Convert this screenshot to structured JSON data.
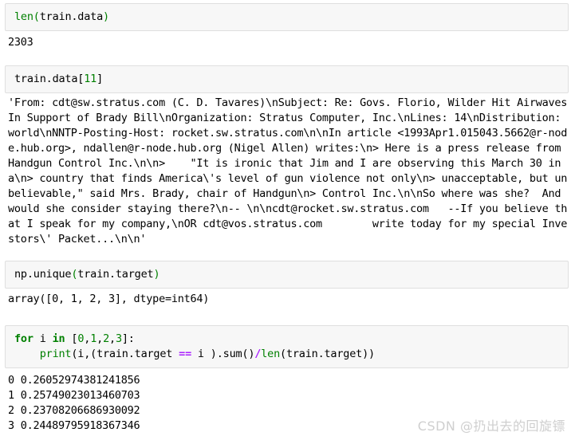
{
  "document": {
    "kind": "jupyter-notebook",
    "watermark": "CSDN @扔出去的回旋镖"
  },
  "cells": [
    {
      "id": "cell-1",
      "type": "code",
      "source_plain": "len(train.data)",
      "tokens": [
        {
          "t": "len",
          "c": "tok-builtin"
        },
        {
          "t": "(",
          "c": "tok-paren"
        },
        {
          "t": "train.data",
          "c": "tok-plain"
        },
        {
          "t": ")",
          "c": "tok-paren"
        }
      ],
      "output": {
        "type": "execute_result",
        "text": "2303"
      }
    },
    {
      "id": "cell-2",
      "type": "code",
      "source_plain": "train.data[11]",
      "tokens": [
        {
          "t": "train.data[",
          "c": "tok-plain"
        },
        {
          "t": "11",
          "c": "tok-number"
        },
        {
          "t": "]",
          "c": "tok-plain"
        }
      ],
      "output": {
        "type": "execute_result",
        "text": "'From: cdt@sw.stratus.com (C. D. Tavares)\\nSubject: Re: Govs. Florio, Wilder Hit Airwaves In Support of Brady Bill\\nOrganization: Stratus Computer, Inc.\\nLines: 14\\nDistribution: world\\nNNTP-Posting-Host: rocket.sw.stratus.com\\n\\nIn article <1993Apr1.015043.5662@r-node.hub.org>, ndallen@r-node.hub.org (Nigel Allen) writes:\\n> Here is a press release from Handgun Control Inc.\\n\\n>    \"It is ironic that Jim and I are observing this March 30 in a\\n> country that finds America\\'s level of gun violence not only\\n> unacceptable, but unbelievable,\" said Mrs. Brady, chair of Handgun\\n> Control Inc.\\n\\nSo where was she?  And would she consider staying there?\\n-- \\n\\ncdt@rocket.sw.stratus.com   --If you believe that I speak for my company,\\nOR cdt@vos.stratus.com        write today for my special Investors\\' Packet...\\n\\n'"
      }
    },
    {
      "id": "cell-3",
      "type": "code",
      "source_plain": "np.unique(train.target)",
      "tokens": [
        {
          "t": "np.unique",
          "c": "tok-plain"
        },
        {
          "t": "(",
          "c": "tok-paren"
        },
        {
          "t": "train.target",
          "c": "tok-plain"
        },
        {
          "t": ")",
          "c": "tok-paren"
        }
      ],
      "output": {
        "type": "execute_result",
        "text": "array([0, 1, 2, 3], dtype=int64)"
      }
    },
    {
      "id": "cell-4",
      "type": "code",
      "source_plain": "for i in [0,1,2,3]:\n    print(i,(train.target == i ).sum()/len(train.target))",
      "lines": [
        [
          {
            "t": "for",
            "c": "tok-keyword"
          },
          {
            "t": " i ",
            "c": "tok-plain"
          },
          {
            "t": "in",
            "c": "tok-keyword"
          },
          {
            "t": " [",
            "c": "tok-plain"
          },
          {
            "t": "0",
            "c": "tok-number"
          },
          {
            "t": ",",
            "c": "tok-plain"
          },
          {
            "t": "1",
            "c": "tok-number"
          },
          {
            "t": ",",
            "c": "tok-plain"
          },
          {
            "t": "2",
            "c": "tok-number"
          },
          {
            "t": ",",
            "c": "tok-plain"
          },
          {
            "t": "3",
            "c": "tok-number"
          },
          {
            "t": "]:",
            "c": "tok-plain"
          }
        ],
        [
          {
            "t": "    ",
            "c": "tok-plain"
          },
          {
            "t": "print",
            "c": "tok-builtin"
          },
          {
            "t": "(i,(train.target ",
            "c": "tok-plain"
          },
          {
            "t": "==",
            "c": "tok-op"
          },
          {
            "t": " i ).sum()",
            "c": "tok-plain"
          },
          {
            "t": "/",
            "c": "tok-op"
          },
          {
            "t": "len",
            "c": "tok-builtin"
          },
          {
            "t": "(train.target))",
            "c": "tok-plain"
          }
        ]
      ],
      "output": {
        "type": "stream",
        "lines": [
          "0 0.2605297438124185",
          "1 0.2574902301346070",
          "2 0.2370820668693009",
          "3 0.2448979591836734"
        ],
        "text": "0 0.26052974381241856\n1 0.25749023013460703\n2 0.23708206686930092\n3 0.24489795918367346"
      }
    }
  ],
  "results": {
    "len_train_data": 2303,
    "unique_targets": [
      0,
      1,
      2,
      3
    ],
    "target_dtype": "int64",
    "class_proportions": [
      {
        "label": 0,
        "value": 0.26052974381241856
      },
      {
        "label": 1,
        "value": 0.25749023013460703
      },
      {
        "label": 2,
        "value": 0.23708206686930092
      },
      {
        "label": 3,
        "value": 0.24489795918367346
      }
    ]
  },
  "colors": {
    "cell_background": "#f7f7f7",
    "cell_border": "#dfdfdf",
    "keyword_green": "#008000",
    "operator_purple": "#aa22ff",
    "text_black": "#000000",
    "watermark_gray": "#cfcfcf"
  }
}
